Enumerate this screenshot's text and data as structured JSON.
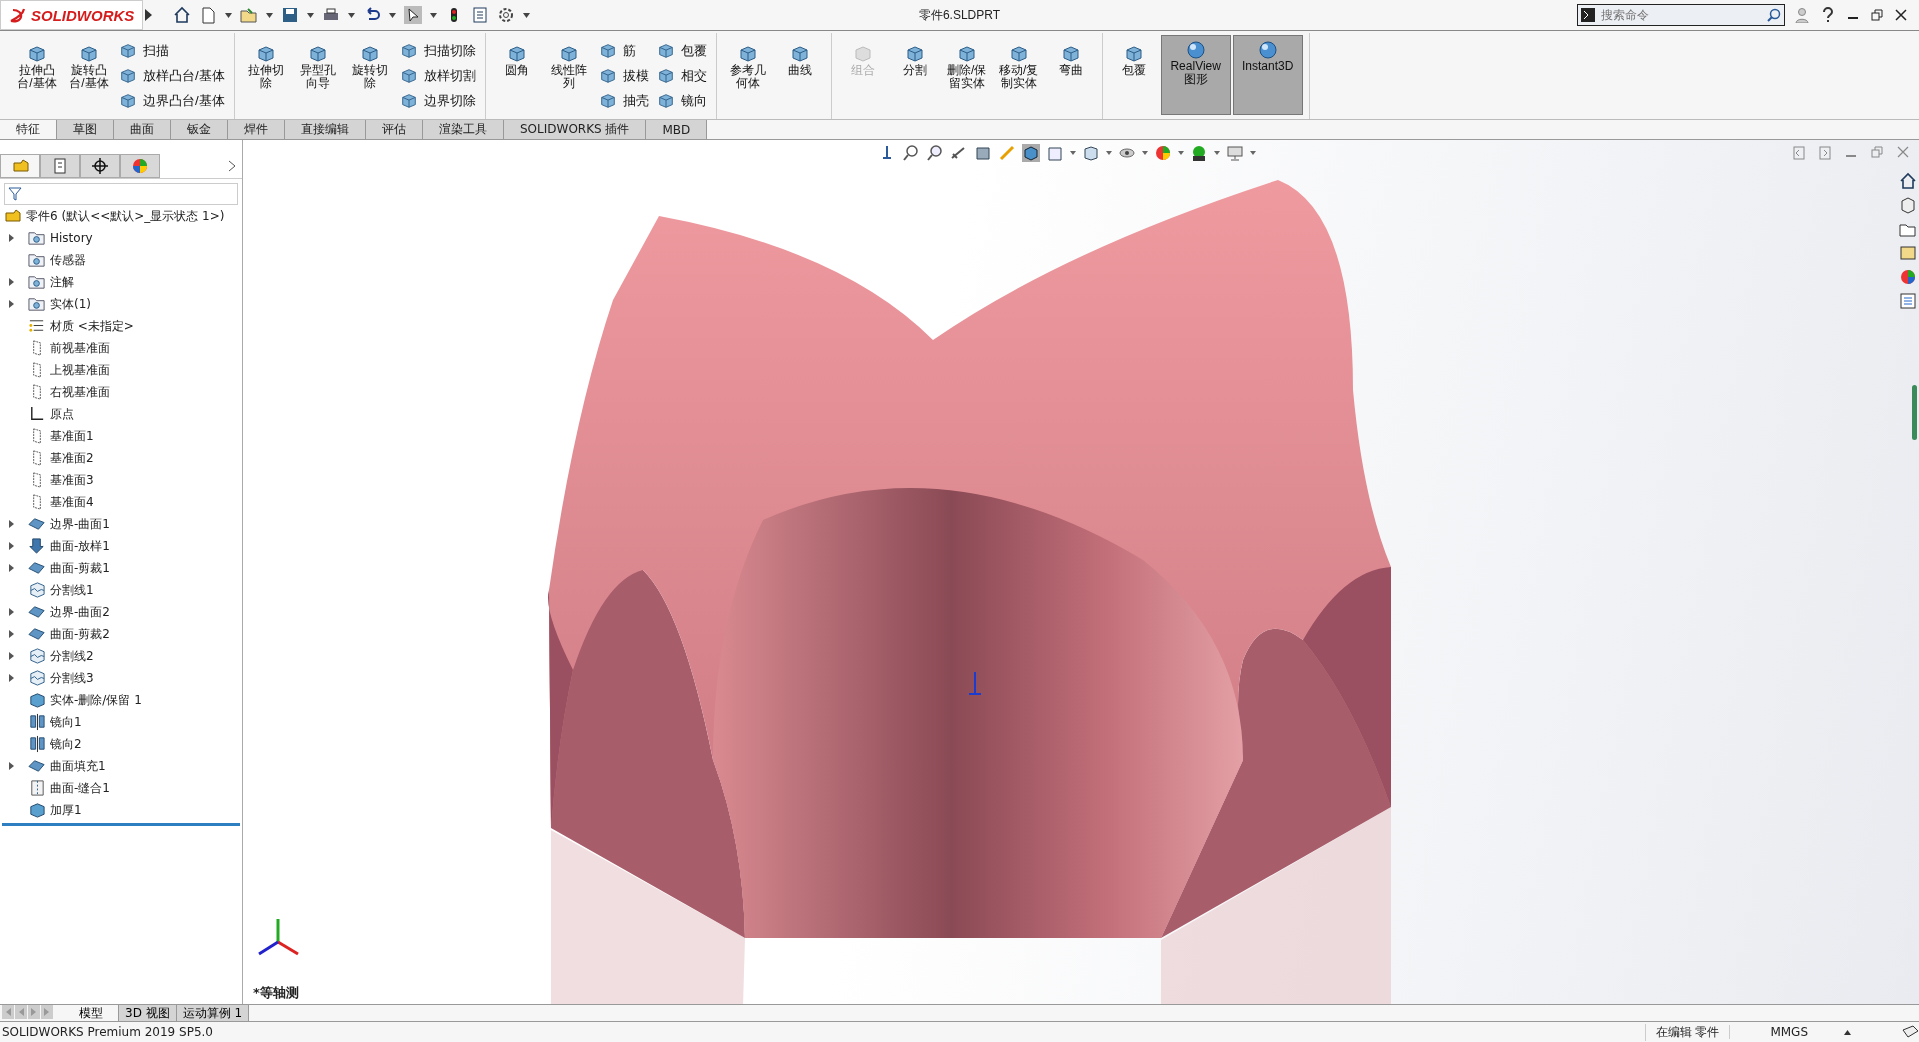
{
  "titlebar": {
    "logo": "SOLIDWORKS",
    "title": "零件6.SLDPRT",
    "search": {
      "placeholder": "搜索命令"
    }
  },
  "ribbon": {
    "groups": [
      {
        "items": [
          {
            "label": "拉伸凸台/基体",
            "kind": "large",
            "disabled": false,
            "on": false
          },
          {
            "label": "旋转凸台/基体",
            "kind": "large",
            "disabled": false,
            "on": false
          },
          {
            "label": "扫描",
            "kind": "small",
            "disabled": false,
            "on": false
          },
          {
            "label": "放样凸台/基体",
            "kind": "small",
            "disabled": false,
            "on": false
          },
          {
            "label": "边界凸台/基体",
            "kind": "small",
            "disabled": false,
            "on": false
          }
        ]
      },
      {
        "items": [
          {
            "label": "拉伸切除",
            "kind": "large",
            "disabled": false,
            "on": false
          },
          {
            "label": "异型孔向导",
            "kind": "large",
            "disabled": false,
            "on": false
          },
          {
            "label": "旋转切除",
            "kind": "large",
            "disabled": false,
            "on": false
          },
          {
            "label": "扫描切除",
            "kind": "small",
            "disabled": false,
            "on": false
          },
          {
            "label": "放样切割",
            "kind": "small",
            "disabled": false,
            "on": false
          },
          {
            "label": "边界切除",
            "kind": "small",
            "disabled": false,
            "on": false
          }
        ]
      },
      {
        "items": [
          {
            "label": "圆角",
            "kind": "large",
            "disabled": false,
            "on": false
          },
          {
            "label": "线性阵列",
            "kind": "large",
            "disabled": false,
            "on": false
          },
          {
            "label": "筋",
            "kind": "small",
            "disabled": false,
            "on": false
          },
          {
            "label": "拔模",
            "kind": "small",
            "disabled": false,
            "on": false
          },
          {
            "label": "抽壳",
            "kind": "small",
            "disabled": false,
            "on": false
          },
          {
            "label": "包覆",
            "kind": "small",
            "disabled": false,
            "on": false
          },
          {
            "label": "相交",
            "kind": "small",
            "disabled": false,
            "on": false
          },
          {
            "label": "镜向",
            "kind": "small",
            "disabled": false,
            "on": false
          }
        ]
      },
      {
        "items": [
          {
            "label": "参考几何体",
            "kind": "large",
            "disabled": false,
            "on": false
          },
          {
            "label": "曲线",
            "kind": "large",
            "disabled": false,
            "on": false
          }
        ]
      },
      {
        "items": [
          {
            "label": "组合",
            "kind": "large",
            "disabled": true,
            "on": false
          },
          {
            "label": "分割",
            "kind": "large",
            "disabled": false,
            "on": false
          },
          {
            "label": "删除/保留实体",
            "kind": "large",
            "disabled": false,
            "on": false
          },
          {
            "label": "移动/复制实体",
            "kind": "large",
            "disabled": false,
            "on": false
          },
          {
            "label": "弯曲",
            "kind": "large",
            "disabled": false,
            "on": false
          }
        ]
      },
      {
        "items": [
          {
            "label": "包覆",
            "kind": "large",
            "disabled": false,
            "on": false
          },
          {
            "label": "RealView 图形",
            "kind": "large",
            "disabled": false,
            "on": true
          },
          {
            "label": "Instant3D",
            "kind": "large",
            "disabled": false,
            "on": true
          }
        ]
      }
    ]
  },
  "tabs": [
    {
      "label": "特征",
      "selected": true
    },
    {
      "label": "草图",
      "selected": false
    },
    {
      "label": "曲面",
      "selected": false
    },
    {
      "label": "钣金",
      "selected": false
    },
    {
      "label": "焊件",
      "selected": false
    },
    {
      "label": "直接编辑",
      "selected": false
    },
    {
      "label": "评估",
      "selected": false
    },
    {
      "label": "渲染工具",
      "selected": false
    },
    {
      "label": "SOLIDWORKS 插件",
      "selected": false
    },
    {
      "label": "MBD",
      "selected": false
    }
  ],
  "panel_tabs": [
    {
      "selected": true
    },
    {
      "selected": false
    },
    {
      "selected": false
    },
    {
      "selected": false
    }
  ],
  "tree": {
    "root": "零件6  (默认<<默认>_显示状态 1>)",
    "items": [
      {
        "label": "History",
        "kind": "folder",
        "expandable": true
      },
      {
        "label": "传感器",
        "kind": "folder",
        "expandable": false
      },
      {
        "label": "注解",
        "kind": "folder",
        "expandable": true
      },
      {
        "label": "实体(1)",
        "kind": "folder",
        "expandable": true
      },
      {
        "label": "材质 <未指定>",
        "kind": "material",
        "expandable": false
      },
      {
        "label": "前视基准面",
        "kind": "plane",
        "expandable": false
      },
      {
        "label": "上视基准面",
        "kind": "plane",
        "expandable": false
      },
      {
        "label": "右视基准面",
        "kind": "plane",
        "expandable": false
      },
      {
        "label": "原点",
        "kind": "origin",
        "expandable": false
      },
      {
        "label": "基准面1",
        "kind": "plane",
        "expandable": false
      },
      {
        "label": "基准面2",
        "kind": "plane",
        "expandable": false
      },
      {
        "label": "基准面3",
        "kind": "plane",
        "expandable": false
      },
      {
        "label": "基准面4",
        "kind": "plane",
        "expandable": false
      },
      {
        "label": "边界-曲面1",
        "kind": "surface",
        "expandable": true
      },
      {
        "label": "曲面-放样1",
        "kind": "loft",
        "expandable": true
      },
      {
        "label": "曲面-剪裁1",
        "kind": "surface",
        "expandable": true
      },
      {
        "label": "分割线1",
        "kind": "split",
        "expandable": false
      },
      {
        "label": "边界-曲面2",
        "kind": "surface",
        "expandable": true
      },
      {
        "label": "曲面-剪裁2",
        "kind": "surface",
        "expandable": true
      },
      {
        "label": "分割线2",
        "kind": "split",
        "expandable": true
      },
      {
        "label": "分割线3",
        "kind": "split",
        "expandable": true
      },
      {
        "label": "实体-删除/保留 1",
        "kind": "solid",
        "expandable": false
      },
      {
        "label": "镜向1",
        "kind": "mirror",
        "expandable": false
      },
      {
        "label": "镜向2",
        "kind": "mirror",
        "expandable": false
      },
      {
        "label": "曲面填充1",
        "kind": "surface",
        "expandable": true
      },
      {
        "label": "曲面-缝合1",
        "kind": "knit",
        "expandable": false
      },
      {
        "label": "加厚1",
        "kind": "solid",
        "expandable": false
      }
    ]
  },
  "viewport": {
    "view_name": "*等轴测"
  },
  "bottom_tabs": [
    {
      "label": "模型",
      "selected": true
    },
    {
      "label": "3D 视图",
      "selected": false
    },
    {
      "label": "运动算例 1",
      "selected": false
    }
  ],
  "status_bar": {
    "product": "SOLIDWORKS Premium 2019 SP5.0",
    "mode": "在编辑 零件",
    "units": "MMGS"
  }
}
